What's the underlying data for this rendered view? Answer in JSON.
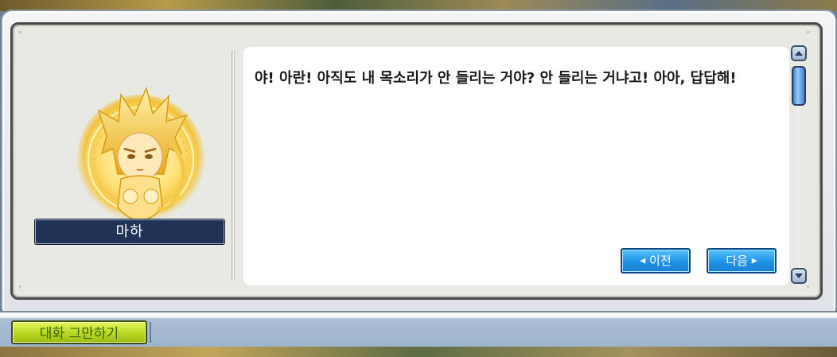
{
  "dialog": {
    "npc_name": "마하",
    "message": "야! 아란! 아직도 내 목소리가 안 들리는 거야? 안 들리는 거냐고! 아아, 답답해!",
    "prev_label": "이전",
    "next_label": "다음",
    "portrait_icon": "npc-portrait-golden-circle"
  },
  "footer": {
    "end_chat_label": "대화 그만하기"
  },
  "colors": {
    "name_plate": "#1f3356",
    "nav_button": "#1e92e6",
    "end_button": "#b8d622"
  }
}
